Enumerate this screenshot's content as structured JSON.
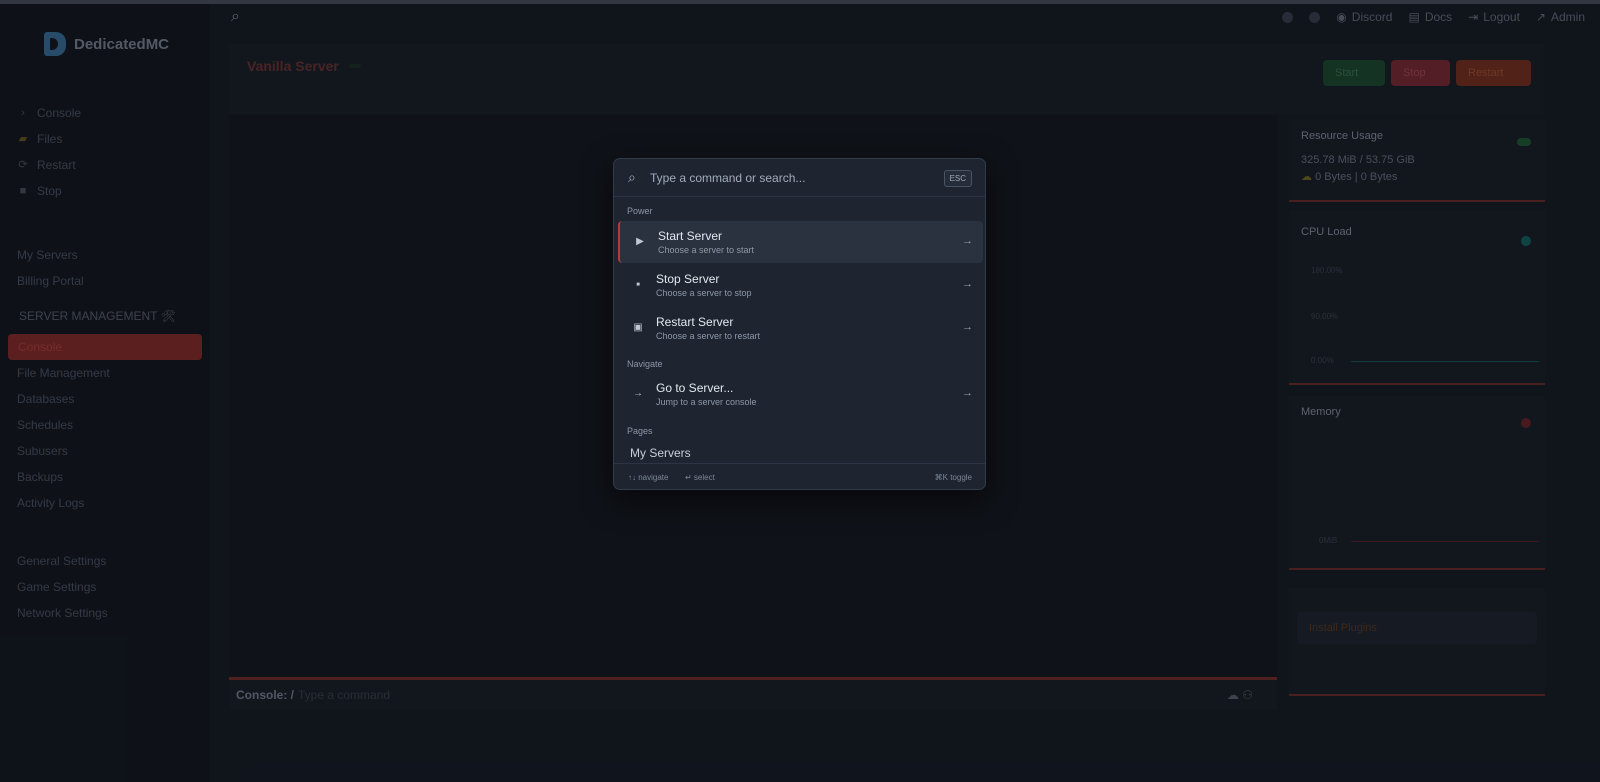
{
  "app": {
    "brand": "DedicatedMC"
  },
  "sidebar": {
    "section1_heading": "",
    "quick_items": [
      {
        "icon": "chevron-right-icon",
        "glyph": "›",
        "label": "Console"
      },
      {
        "icon": "folder-icon",
        "glyph": "▰",
        "label": "Files"
      },
      {
        "icon": "restart-icon",
        "glyph": "⟳",
        "label": "Restart"
      },
      {
        "icon": "stop-icon",
        "glyph": "■",
        "label": "Stop"
      }
    ],
    "section2_heading": "",
    "account_items": [
      {
        "label": "My Servers"
      },
      {
        "label": "Billing Portal"
      }
    ],
    "management_heading": "SERVER MANAGEMENT 🛠",
    "management_items": [
      {
        "label": "Console",
        "active": true
      },
      {
        "label": "File Management"
      },
      {
        "label": "Databases"
      },
      {
        "label": "Schedules"
      },
      {
        "label": "Subusers"
      },
      {
        "label": "Backups"
      },
      {
        "label": "Activity Logs"
      }
    ],
    "section3_heading": "",
    "settings_items": [
      {
        "label": "General Settings"
      },
      {
        "label": "Game Settings"
      },
      {
        "label": "Network Settings"
      }
    ]
  },
  "topbar": {
    "links": [
      {
        "icon": "discord-icon",
        "label": "Discord"
      },
      {
        "icon": "docs-icon",
        "label": "Docs"
      },
      {
        "icon": "logout-icon",
        "label": "Logout"
      },
      {
        "icon": "admin-icon",
        "label": "Admin"
      }
    ]
  },
  "server": {
    "name": "Vanilla Server",
    "status": "",
    "buttons": {
      "start": "Start",
      "stop": "Stop",
      "restart": "Restart"
    }
  },
  "console": {
    "label": "Console: /",
    "placeholder": "Type a command"
  },
  "resources": {
    "title": "Resource Usage",
    "storage_value": "325.78 MiB / 53.75 GiB",
    "network_value": "0 Bytes | 0 Bytes",
    "accent": "#1f8a4a"
  },
  "cpu": {
    "title": "CPU Load",
    "axis": [
      "180.00%",
      "90.00%",
      "0.00%"
    ],
    "accent": "#1a9a8a"
  },
  "memory": {
    "title": "Memory",
    "axis": [
      "",
      "",
      "0MiB"
    ],
    "accent": "#a0303a"
  },
  "plugins": {
    "heading": "",
    "button": "Install Plugins",
    "link": ""
  },
  "footer": {
    "text": ""
  },
  "palette": {
    "placeholder": "Type a command or search...",
    "esc": "ESC",
    "sections": {
      "power": "Power",
      "navigate": "Navigate",
      "pages": "Pages"
    },
    "commands": [
      {
        "icon": "play-icon",
        "glyph": "▶",
        "title": "Start Server",
        "desc": "Choose a server to start",
        "selected": true
      },
      {
        "icon": "stop-icon",
        "glyph": "■",
        "title": "Stop Server",
        "desc": "Choose a server to stop"
      },
      {
        "icon": "restart-icon",
        "glyph": "▣",
        "title": "Restart Server",
        "desc": "Choose a server to restart"
      }
    ],
    "navigate": [
      {
        "icon": "arrow-right-icon",
        "glyph": "→",
        "title": "Go to Server...",
        "desc": "Jump to a server console"
      }
    ],
    "page_item": "My Servers",
    "footer": {
      "navigate": "↑↓ navigate",
      "select": "↵ select",
      "toggle": "⌘K toggle"
    }
  }
}
